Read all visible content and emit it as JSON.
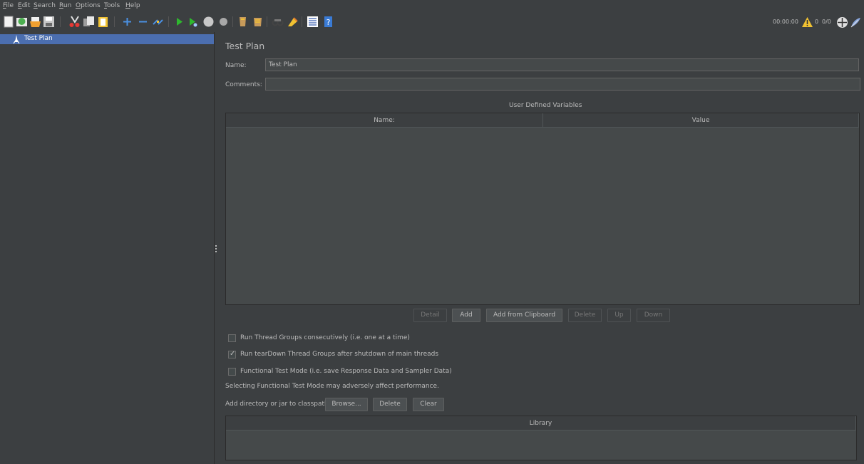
{
  "menu": [
    {
      "mnemonic": "F",
      "rest": "ile"
    },
    {
      "mnemonic": "E",
      "rest": "dit"
    },
    {
      "mnemonic": "S",
      "rest": "earch"
    },
    {
      "mnemonic": "R",
      "rest": "un"
    },
    {
      "mnemonic": "O",
      "rest": "ptions"
    },
    {
      "mnemonic": "T",
      "rest": "ools"
    },
    {
      "mnemonic": "H",
      "rest": "elp"
    }
  ],
  "status": {
    "timer": "00:00:00",
    "warnings": "0",
    "threads": "0/0"
  },
  "tree": {
    "root_label": "Test Plan"
  },
  "panel": {
    "title": "Test Plan",
    "name_label": "Name:",
    "name_value": "Test Plan",
    "comments_label": "Comments:",
    "comments_value": "",
    "udv_title": "User Defined Variables",
    "udv_columns": [
      "Name:",
      "Value"
    ],
    "buttons": {
      "detail": "Detail",
      "add": "Add",
      "add_from_clipboard": "Add from Clipboard",
      "delete": "Delete",
      "up": "Up",
      "down": "Down"
    },
    "checkboxes": [
      {
        "label": "Run Thread Groups consecutively (i.e. one at a time)",
        "checked": false
      },
      {
        "label": "Run tearDown Thread Groups after shutdown of main threads",
        "checked": true
      },
      {
        "label": "Functional Test Mode (i.e. save Response Data and Sampler Data)",
        "checked": false
      }
    ],
    "functional_note": "Selecting Functional Test Mode may adversely affect performance.",
    "classpath_label": "Add directory or jar to classpath",
    "classpath_buttons": {
      "browse": "Browse...",
      "delete": "Delete",
      "clear": "Clear"
    },
    "library_column": "Library"
  },
  "colors": {
    "background": "#3c3f41",
    "selection": "#4b6eaf",
    "field": "#45494a",
    "text": "#bbbbbb"
  }
}
